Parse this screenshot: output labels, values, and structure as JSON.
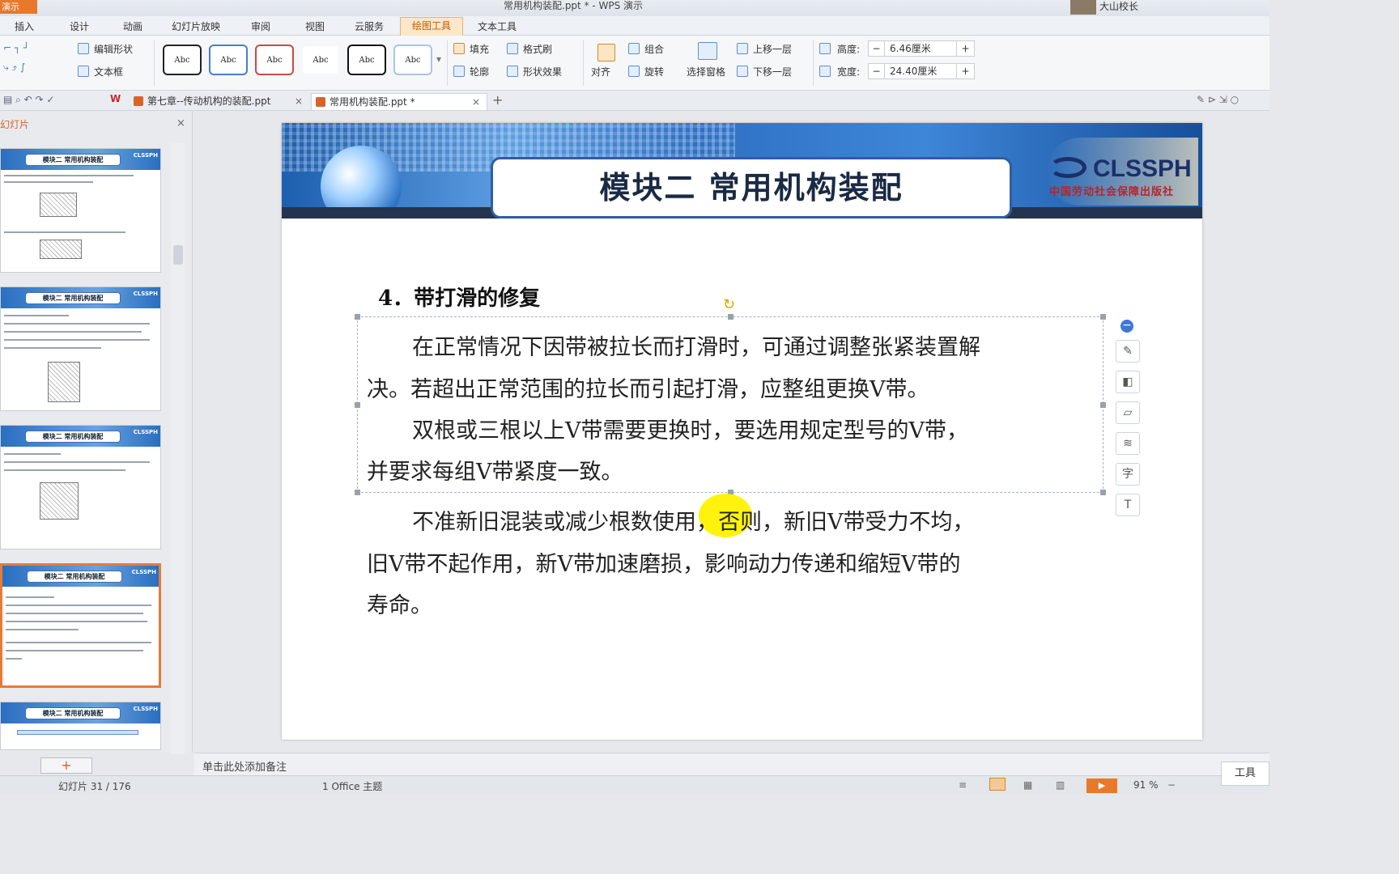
{
  "app": {
    "app_button": "演示",
    "title": "常用机构装配.ppt * - WPS 演示",
    "user": "大山校长"
  },
  "menu": {
    "tabs": [
      "插入",
      "设计",
      "动画",
      "幻灯片放映",
      "审阅",
      "视图",
      "云服务",
      "绘图工具",
      "文本工具"
    ],
    "active": "绘图工具"
  },
  "ribbon": {
    "edit_shape": "编辑形状",
    "textbox": "文本框",
    "style_label": "Abc",
    "fill": "填充",
    "format_painter": "格式刷",
    "outline": "轮廓",
    "shape_effects": "形状效果",
    "align": "对齐",
    "group": "组合",
    "rotate": "旋转",
    "selection_pane": "选择窗格",
    "bring_forward": "上移一层",
    "send_backward": "下移一层",
    "height_label": "高度:",
    "height_value": "6.46厘米",
    "width_label": "宽度:",
    "width_value": "24.40厘米"
  },
  "doc_tabs": [
    {
      "label": "第七章--传动机构的装配.ppt"
    },
    {
      "label": "常用机构装配.ppt *"
    }
  ],
  "panel": {
    "header": "幻灯片",
    "thumb_title": "模块二  常用机构装配",
    "thumb_logo": "CLSSPH",
    "add_slide": "+"
  },
  "slide": {
    "banner_title": "模块二   常用机构装配",
    "logo_text": "CLSSPH",
    "logo_sub": "中国劳动社会保障出版社",
    "heading": "4．带打滑的修复",
    "p1_line1": "在正常情况下因带被拉长而打滑时，可通过调整张紧装置解",
    "p1_line2": "决。若超出正常范围的拉长而引起打滑，应整组更换V带。",
    "p2_line1": "双根或三根以上V带需要更换时，要选用规定型号的V带，",
    "p2_line2": "并要求每组V带紧度一致。",
    "p3_line1": "不准新旧混装或减少根数使用，否则，新旧V带受力不均，",
    "p3_line2": "旧V带不起作用，新V带加速磨损，影响动力传递和缩短V带的",
    "p3_line3": "寿命。"
  },
  "notes": {
    "placeholder": "单击此处添加备注"
  },
  "status": {
    "slide_counter": "幻灯片 31 / 176",
    "theme": "1 Office 主题",
    "zoom": "91 %",
    "tools": "工具"
  }
}
